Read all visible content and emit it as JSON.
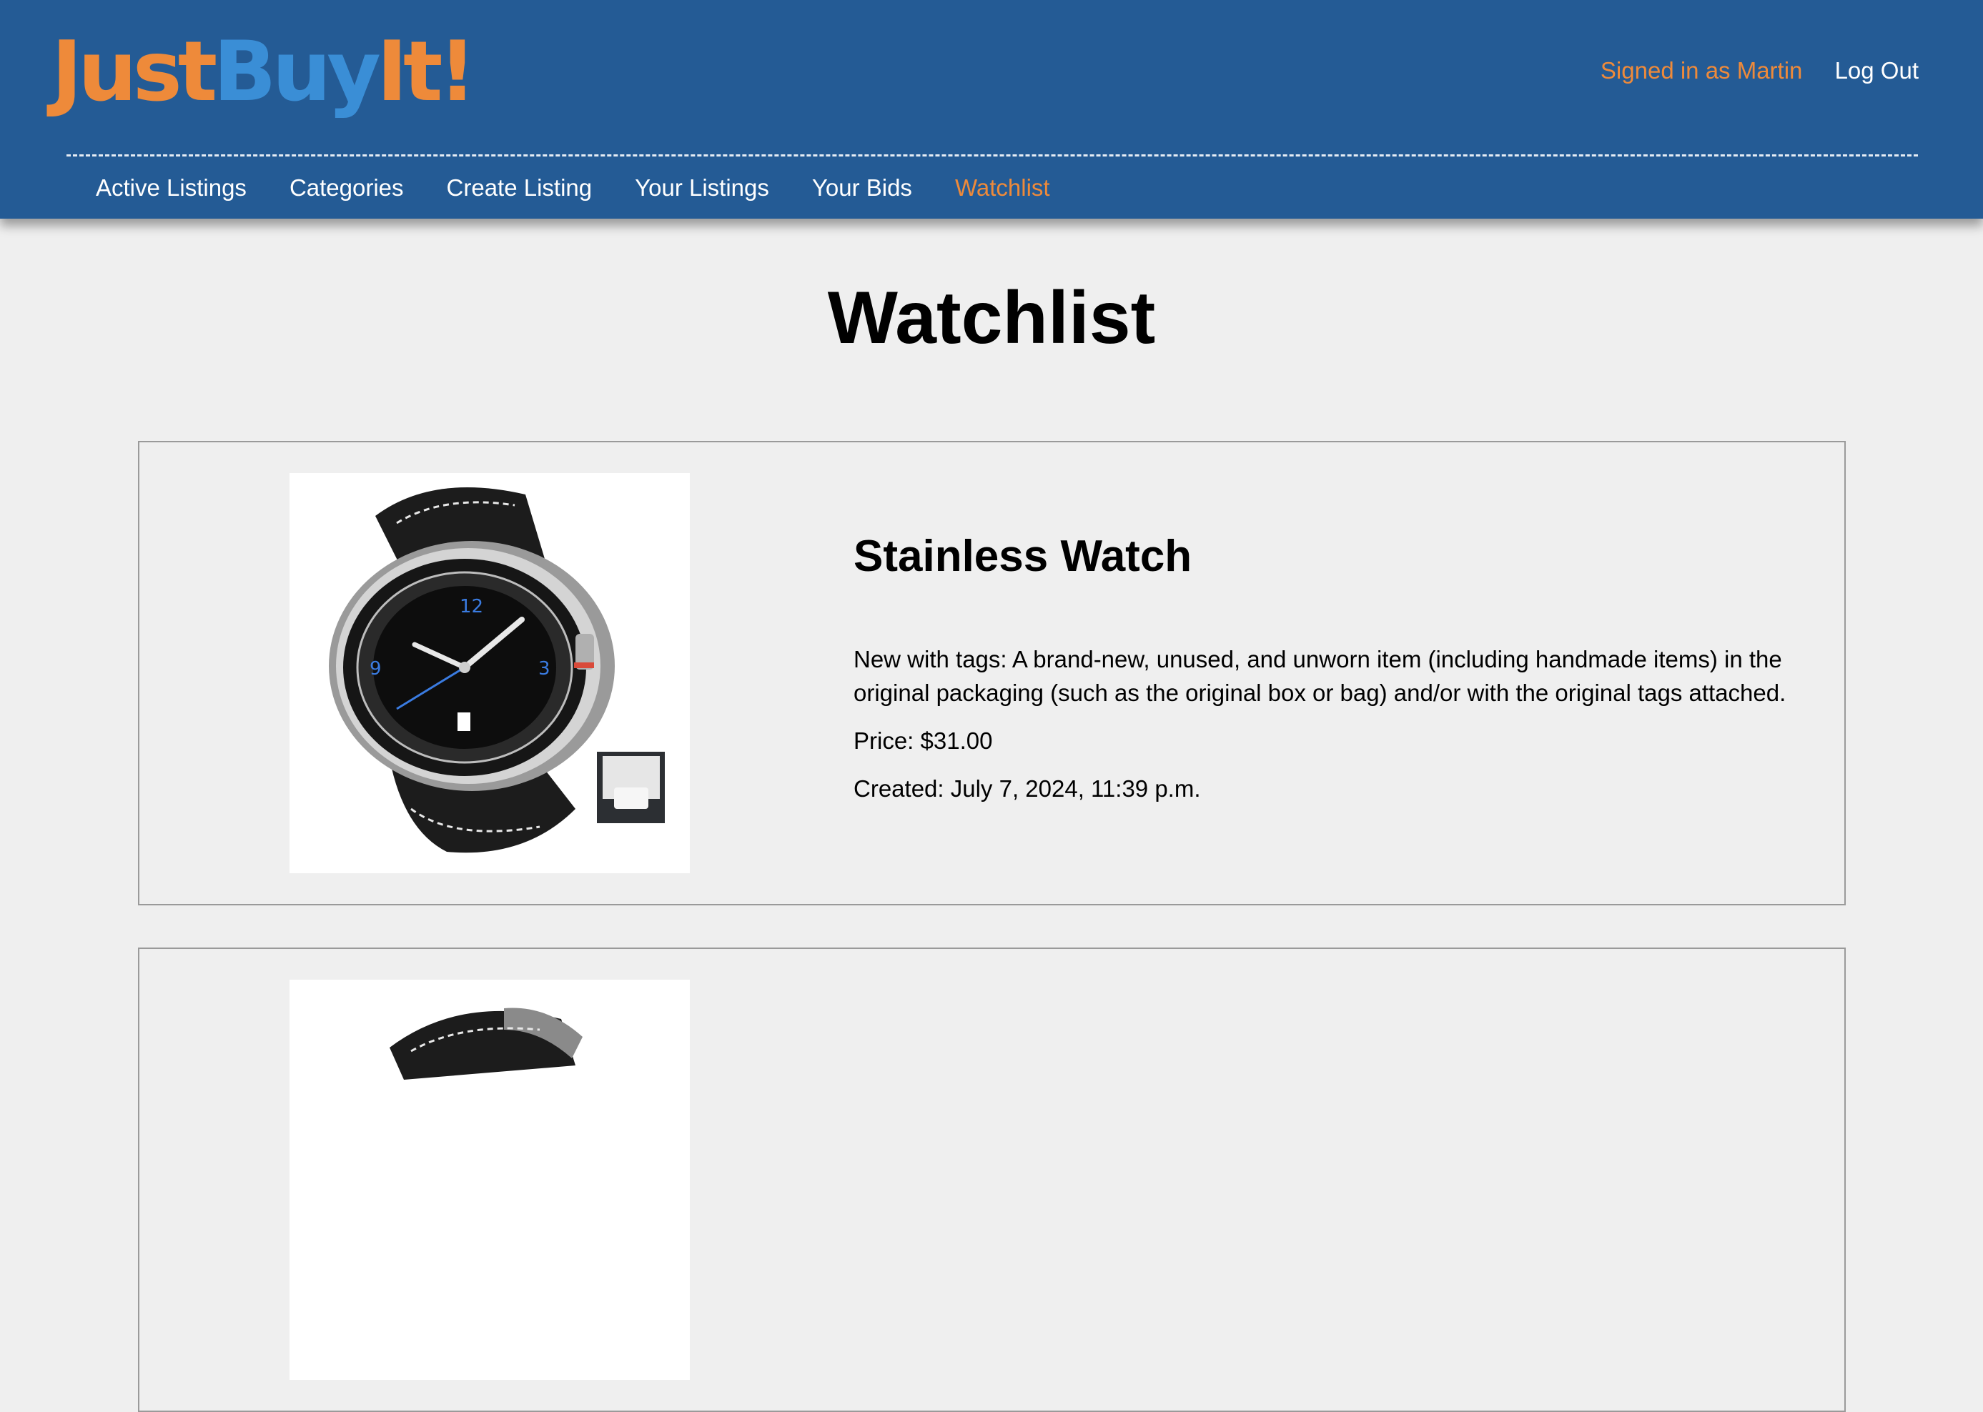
{
  "brand": {
    "part1": "Just",
    "part2": "Buy",
    "part3": "It!",
    "colors": {
      "orange": "#ee8a3a",
      "blue": "#3a8ed6",
      "header_bg": "#245b95"
    }
  },
  "account": {
    "signed_in": "Signed in as Martin",
    "logout": "Log Out"
  },
  "nav": {
    "items": [
      {
        "label": "Active Listings"
      },
      {
        "label": "Categories"
      },
      {
        "label": "Create Listing"
      },
      {
        "label": "Your Listings"
      },
      {
        "label": "Your Bids"
      },
      {
        "label": "Watchlist",
        "active": true
      }
    ]
  },
  "page": {
    "title": "Watchlist"
  },
  "listings": [
    {
      "title": "Stainless Watch",
      "description": "New with tags: A brand-new, unused, and unworn item (including handmade items) in the original packaging (such as the original box or bag) and/or with the original tags attached.",
      "price": "Price: $31.00",
      "created": "Created: July 7, 2024, 11:39 p.m.",
      "image_icon": "watch-icon"
    },
    {
      "image_icon": "watch-icon"
    }
  ]
}
